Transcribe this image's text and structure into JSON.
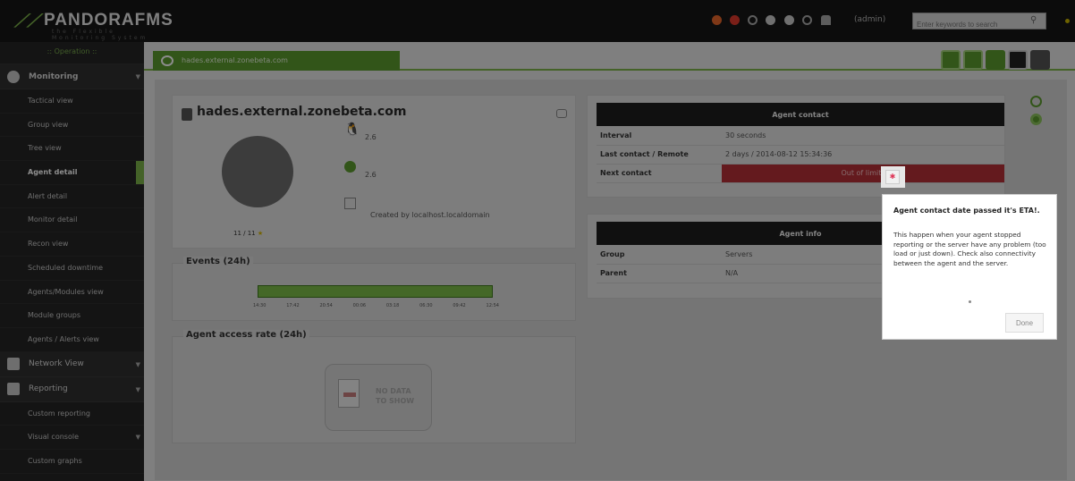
{
  "header": {
    "logo_text": "PANDORAFMS",
    "logo_tagline": "the Flexible Monitoring System",
    "user": "(admin)",
    "search_placeholder": "Enter keywords to search"
  },
  "sidebar": {
    "operation_label": ":: Operation ::",
    "monitoring_label": "Monitoring",
    "monitoring_items": [
      "Tactical view",
      "Group view",
      "Tree view",
      "Agent detail",
      "Alert detail",
      "Monitor detail",
      "Recon view",
      "Scheduled downtime",
      "Agents/Modules view",
      "Module groups",
      "Agents / Alerts view"
    ],
    "network_label": "Network View",
    "reporting_label": "Reporting",
    "reporting_items": [
      "Custom reporting",
      "Visual console",
      "Custom graphs"
    ]
  },
  "breadcrumb": {
    "label": "hades.external.zonebeta.com"
  },
  "agent": {
    "name": "hades.external.zonebeta.com",
    "os_version": "2.6",
    "agent_version": "2.6",
    "description": "Created by localhost.localdomain",
    "module_count": "11 / 11"
  },
  "events": {
    "title": "Events (24h)",
    "time_labels": [
      "14:30",
      "17:42",
      "20:54",
      "00:06",
      "03:18",
      "06:30",
      "09:42",
      "12:54"
    ]
  },
  "access_rate": {
    "title": "Agent access rate (24h)",
    "no_data_1": "NO DATA",
    "no_data_2": "TO SHOW"
  },
  "contact": {
    "header": "Agent contact",
    "interval_label": "Interval",
    "interval_value": "30 seconds",
    "last_label": "Last contact / Remote",
    "last_value": "2 days / 2014-08-12 15:34:36",
    "next_label": "Next contact",
    "next_value": "Out of limits"
  },
  "agent_info": {
    "header": "Agent info",
    "group_label": "Group",
    "group_value": "Servers",
    "parent_label": "Parent",
    "parent_value": "N/A"
  },
  "tooltip": {
    "title": "Agent contact date passed it's ETA!.",
    "body": "This happen when your agent stopped reporting or the server have any problem (too load or just down). Check also connectivity between the agent and the server.",
    "done_label": "Done"
  },
  "colors": {
    "accent_green": "#7cb34a",
    "alert_red": "#b73038",
    "dark": "#161616"
  }
}
